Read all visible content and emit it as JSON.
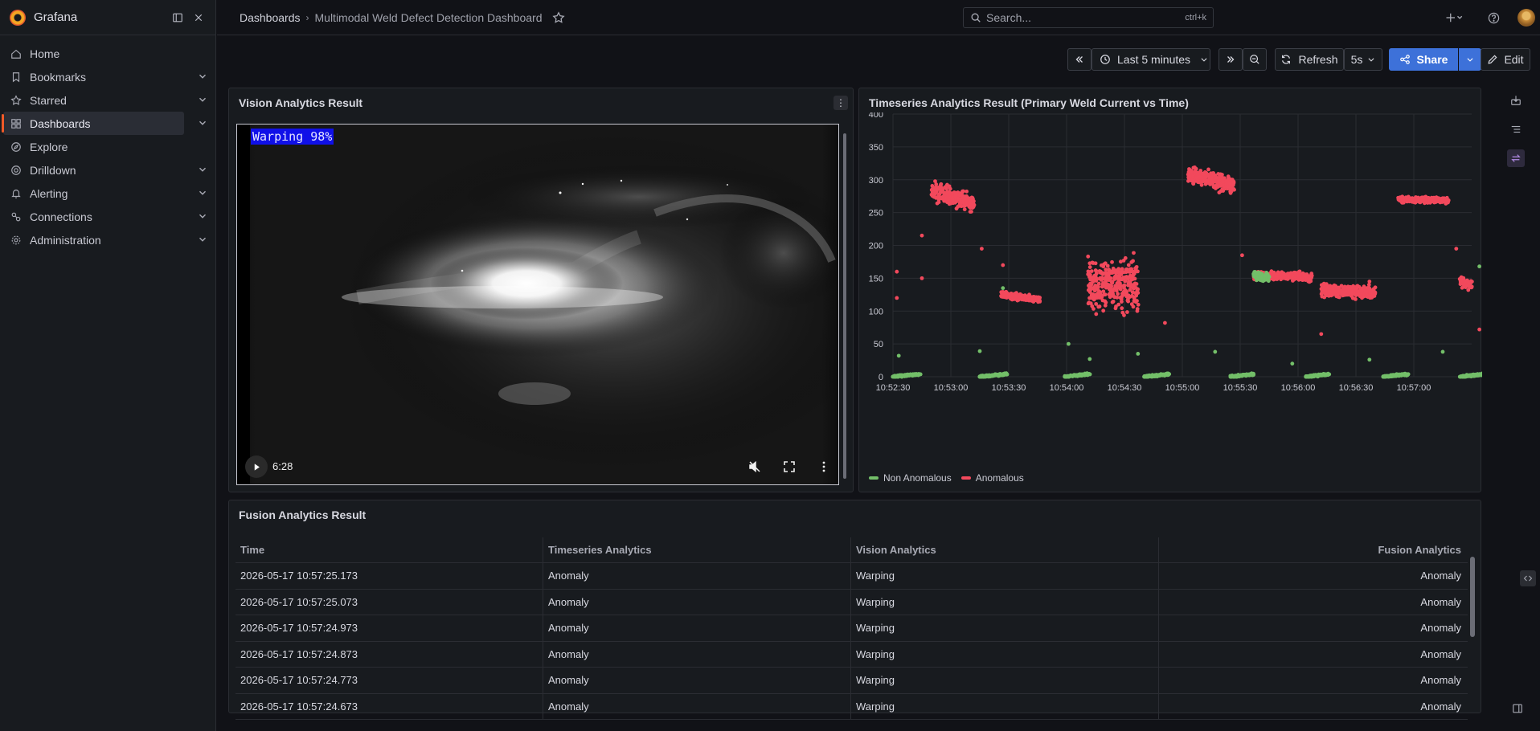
{
  "app": {
    "brand": "Grafana"
  },
  "sidebar": {
    "items": [
      {
        "label": "Home",
        "icon": "home-icon",
        "chevron": false,
        "active": false
      },
      {
        "label": "Bookmarks",
        "icon": "bookmark-icon",
        "chevron": true,
        "active": false
      },
      {
        "label": "Starred",
        "icon": "star-icon",
        "chevron": true,
        "active": false
      },
      {
        "label": "Dashboards",
        "icon": "dashboards-icon",
        "chevron": true,
        "active": true
      },
      {
        "label": "Explore",
        "icon": "explore-icon",
        "chevron": false,
        "active": false
      },
      {
        "label": "Drilldown",
        "icon": "drilldown-icon",
        "chevron": true,
        "active": false
      },
      {
        "label": "Alerting",
        "icon": "bell-icon",
        "chevron": true,
        "active": false
      },
      {
        "label": "Connections",
        "icon": "connections-icon",
        "chevron": true,
        "active": false
      },
      {
        "label": "Administration",
        "icon": "gear-icon",
        "chevron": true,
        "active": false
      }
    ]
  },
  "breadcrumb": {
    "parent": "Dashboards",
    "current": "Multimodal Weld Defect Detection Dashboard"
  },
  "search": {
    "placeholder": "Search...",
    "shortcut": "ctrl+k"
  },
  "toolbar": {
    "time_range": "Last 5 minutes",
    "refresh_label": "Refresh",
    "refresh_interval": "5s",
    "share_label": "Share",
    "edit_label": "Edit"
  },
  "vision_panel": {
    "title": "Vision Analytics Result",
    "overlay_label": "Warping 98%",
    "video_time": "6:28"
  },
  "timeseries_panel": {
    "title": "Timeseries Analytics Result (Primary Weld Current vs Time)",
    "legend": [
      {
        "name": "Non Anomalous",
        "color": "#73bf69"
      },
      {
        "name": "Anomalous",
        "color": "#f2495c"
      }
    ]
  },
  "chart_data": {
    "type": "scatter",
    "x_ticks": [
      "10:52:30",
      "10:53:00",
      "10:53:30",
      "10:54:00",
      "10:54:30",
      "10:55:00",
      "10:55:30",
      "10:56:00",
      "10:56:30",
      "10:57:00"
    ],
    "y_ticks": [
      0,
      50,
      100,
      150,
      200,
      250,
      300,
      350,
      400
    ],
    "ylim": [
      0,
      400
    ],
    "grid": true,
    "legend_position": "bottom-left",
    "series": [
      {
        "name": "Anomalous",
        "color": "#f2495c",
        "clusters": [
          {
            "x_start": "10:52:50",
            "x_end": "10:53:12",
            "y_start": 285,
            "y_end": 265,
            "spread": 20
          },
          {
            "x_start": "10:53:26",
            "x_end": "10:53:46",
            "y_start": 125,
            "y_end": 118,
            "spread": 7
          },
          {
            "x_start": "10:54:11",
            "x_end": "10:54:37",
            "y_start": 140,
            "y_end": 140,
            "spread": 55
          },
          {
            "x_start": "10:55:03",
            "x_end": "10:55:27",
            "y_start": 308,
            "y_end": 290,
            "spread": 18
          },
          {
            "x_start": "10:55:37",
            "x_end": "10:56:07",
            "y_start": 155,
            "y_end": 152,
            "spread": 9
          },
          {
            "x_start": "10:56:12",
            "x_end": "10:56:40",
            "y_start": 132,
            "y_end": 128,
            "spread": 14
          },
          {
            "x_start": "10:56:52",
            "x_end": "10:57:18",
            "y_start": 270,
            "y_end": 268,
            "spread": 6
          },
          {
            "x_start": "10:57:24",
            "x_end": "10:57:30",
            "y_start": 145,
            "y_end": 138,
            "spread": 12
          }
        ]
      },
      {
        "name": "Non Anomalous",
        "color": "#73bf69",
        "clusters": [
          {
            "x_start": "10:52:30",
            "x_end": "10:52:44",
            "y_start": 0,
            "y_end": 4,
            "spread": 2
          },
          {
            "x_start": "10:53:15",
            "x_end": "10:53:29",
            "y_start": 0,
            "y_end": 4,
            "spread": 2
          },
          {
            "x_start": "10:53:59",
            "x_end": "10:54:12",
            "y_start": 0,
            "y_end": 4,
            "spread": 2
          },
          {
            "x_start": "10:54:40",
            "x_end": "10:54:53",
            "y_start": 0,
            "y_end": 4,
            "spread": 2
          },
          {
            "x_start": "10:55:25",
            "x_end": "10:55:37",
            "y_start": 0,
            "y_end": 4,
            "spread": 2
          },
          {
            "x_start": "10:56:04",
            "x_end": "10:56:16",
            "y_start": 0,
            "y_end": 4,
            "spread": 2
          },
          {
            "x_start": "10:56:44",
            "x_end": "10:56:57",
            "y_start": 0,
            "y_end": 4,
            "spread": 2
          },
          {
            "x_start": "10:57:24",
            "x_end": "10:57:37",
            "y_start": 0,
            "y_end": 4,
            "spread": 2
          },
          {
            "x_start": "10:55:37",
            "x_end": "10:55:45",
            "y_start": 155,
            "y_end": 150,
            "spread": 9
          }
        ]
      }
    ]
  },
  "fusion_panel": {
    "title": "Fusion Analytics Result",
    "columns": [
      "Time",
      "Timeseries Analytics",
      "Vision Analytics",
      "Fusion Analytics"
    ],
    "rows": [
      [
        "2026-05-17 10:57:25.173",
        "Anomaly",
        "Warping",
        "Anomaly"
      ],
      [
        "2026-05-17 10:57:25.073",
        "Anomaly",
        "Warping",
        "Anomaly"
      ],
      [
        "2026-05-17 10:57:24.973",
        "Anomaly",
        "Warping",
        "Anomaly"
      ],
      [
        "2026-05-17 10:57:24.873",
        "Anomaly",
        "Warping",
        "Anomaly"
      ],
      [
        "2026-05-17 10:57:24.773",
        "Anomaly",
        "Warping",
        "Anomaly"
      ],
      [
        "2026-05-17 10:57:24.673",
        "Anomaly",
        "Warping",
        "Anomaly"
      ]
    ]
  }
}
